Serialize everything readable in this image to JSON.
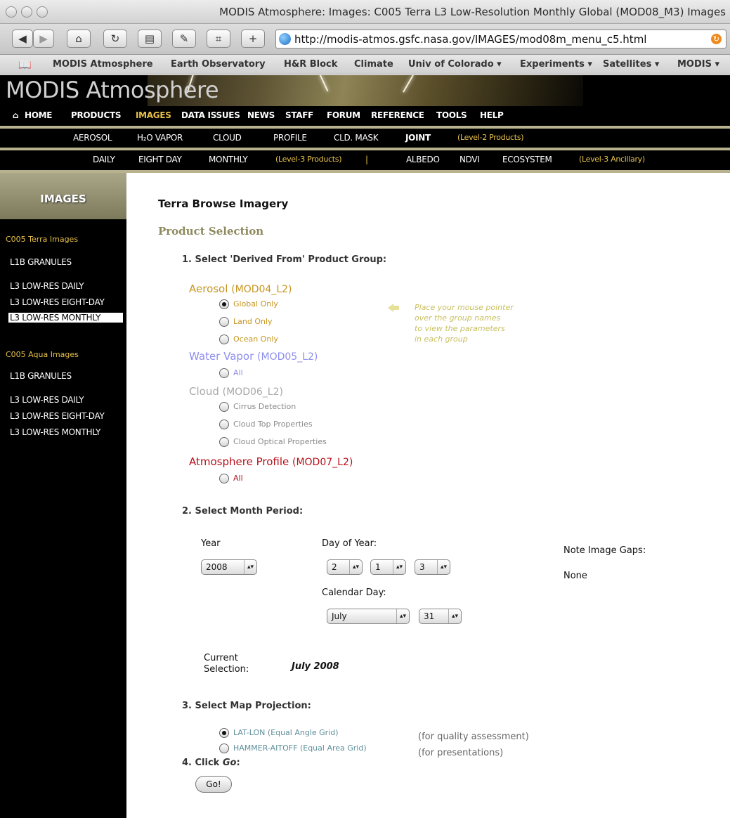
{
  "window": {
    "title": "MODIS Atmosphere: Images: C005 Terra L3 Low-Resolution Monthly Global (MOD08_M3) Images"
  },
  "toolbar": {
    "back_icon": "back-arrow-icon",
    "forward_icon": "forward-arrow-icon",
    "home_icon": "home-icon",
    "reload_icon": "reload-icon",
    "print_icon": "print-icon",
    "edit_icon": "edit-icon",
    "add_label": "+",
    "url": "http://modis-atmos.gsfc.nasa.gov/IMAGES/mod08m_menu_c5.html"
  },
  "bookmarks": [
    "MODIS Atmosphere",
    "Earth Observatory",
    "H&R Block",
    "Climate",
    "Univ of Colorado ▾",
    "Experiments ▾",
    "Satellites ▾",
    "MODIS ▾"
  ],
  "banner": {
    "title": "MODIS Atmosphere"
  },
  "nav_main": [
    "HOME",
    "PRODUCTS",
    "IMAGES",
    "DATA ISSUES",
    "NEWS",
    "STAFF",
    "FORUM",
    "REFERENCE",
    "TOOLS",
    "HELP"
  ],
  "nav_level2": [
    "AEROSOL",
    "H₂O VAPOR",
    "CLOUD",
    "PROFILE",
    "CLD. MASK",
    "JOINT",
    "(Level-2 Products)"
  ],
  "nav_level3": [
    "DAILY",
    "EIGHT DAY",
    "MONTHLY",
    "(Level-3 Products)",
    "|",
    "ALBEDO",
    "NDVI",
    "ECOSYSTEM",
    "(Level-3 Ancillary)"
  ],
  "sidebar": {
    "heading": "IMAGES",
    "terra_label": "C005 Terra Images",
    "terra_items": [
      "L1B GRANULES",
      "L3 LOW-RES DAILY",
      "L3 LOW-RES EIGHT-DAY",
      "L3 LOW-RES MONTHLY"
    ],
    "aqua_label": "C005 Aqua Images",
    "aqua_items": [
      "L1B GRANULES",
      "L3 LOW-RES DAILY",
      "L3 LOW-RES EIGHT-DAY",
      "L3 LOW-RES MONTHLY"
    ]
  },
  "main": {
    "title": "Terra Browse Imagery",
    "product_selection": "Product Selection",
    "step1": "1. Select 'Derived From' Product Group:",
    "groups": {
      "aerosol": {
        "name": "Aerosol",
        "code": "(MOD04_L2)",
        "color": "#c7951f",
        "options": [
          "Global Only",
          "Land Only",
          "Ocean Only"
        ]
      },
      "water": {
        "name": "Water Vapor",
        "code": "(MOD05_L2)",
        "color": "#8d8df0",
        "options": [
          "All"
        ]
      },
      "cloud": {
        "name": "Cloud",
        "code": "(MOD06_L2)",
        "color": "#a8a8a8",
        "options": [
          "Cirrus Detection",
          "Cloud Top Properties",
          "Cloud Optical Properties"
        ]
      },
      "profile": {
        "name": "Atmosphere Profile",
        "code": "(MOD07_L2)",
        "color": "#b5101a",
        "options": [
          "All"
        ]
      }
    },
    "hint_lines": [
      "Place your mouse pointer",
      "over the group names",
      "to view the parameters",
      "in each group"
    ],
    "step2": "2. Select Month Period:",
    "year_label": "Year",
    "year_value": "2008",
    "doy_label": "Day of Year:",
    "doy_values": [
      "2",
      "1",
      "3"
    ],
    "calendar_label": "Calendar Day:",
    "month_value": "July",
    "day_value": "31",
    "gaps_label": "Note Image Gaps:",
    "gaps_value": "None",
    "current_label_1": "Current",
    "current_label_2": "Selection:",
    "current_value": "July 2008",
    "step3": "3. Select Map Projection:",
    "projections": [
      {
        "label": "LAT-LON  (Equal Angle Grid)",
        "note": "(for quality assessment)"
      },
      {
        "label": "HAMMER-AITOFF  (Equal Area Grid)",
        "note": "(for presentations)"
      }
    ],
    "step4_prefix": "4. Click ",
    "step4_go": "Go",
    "step4_suffix": ":",
    "go_button": "Go!"
  }
}
